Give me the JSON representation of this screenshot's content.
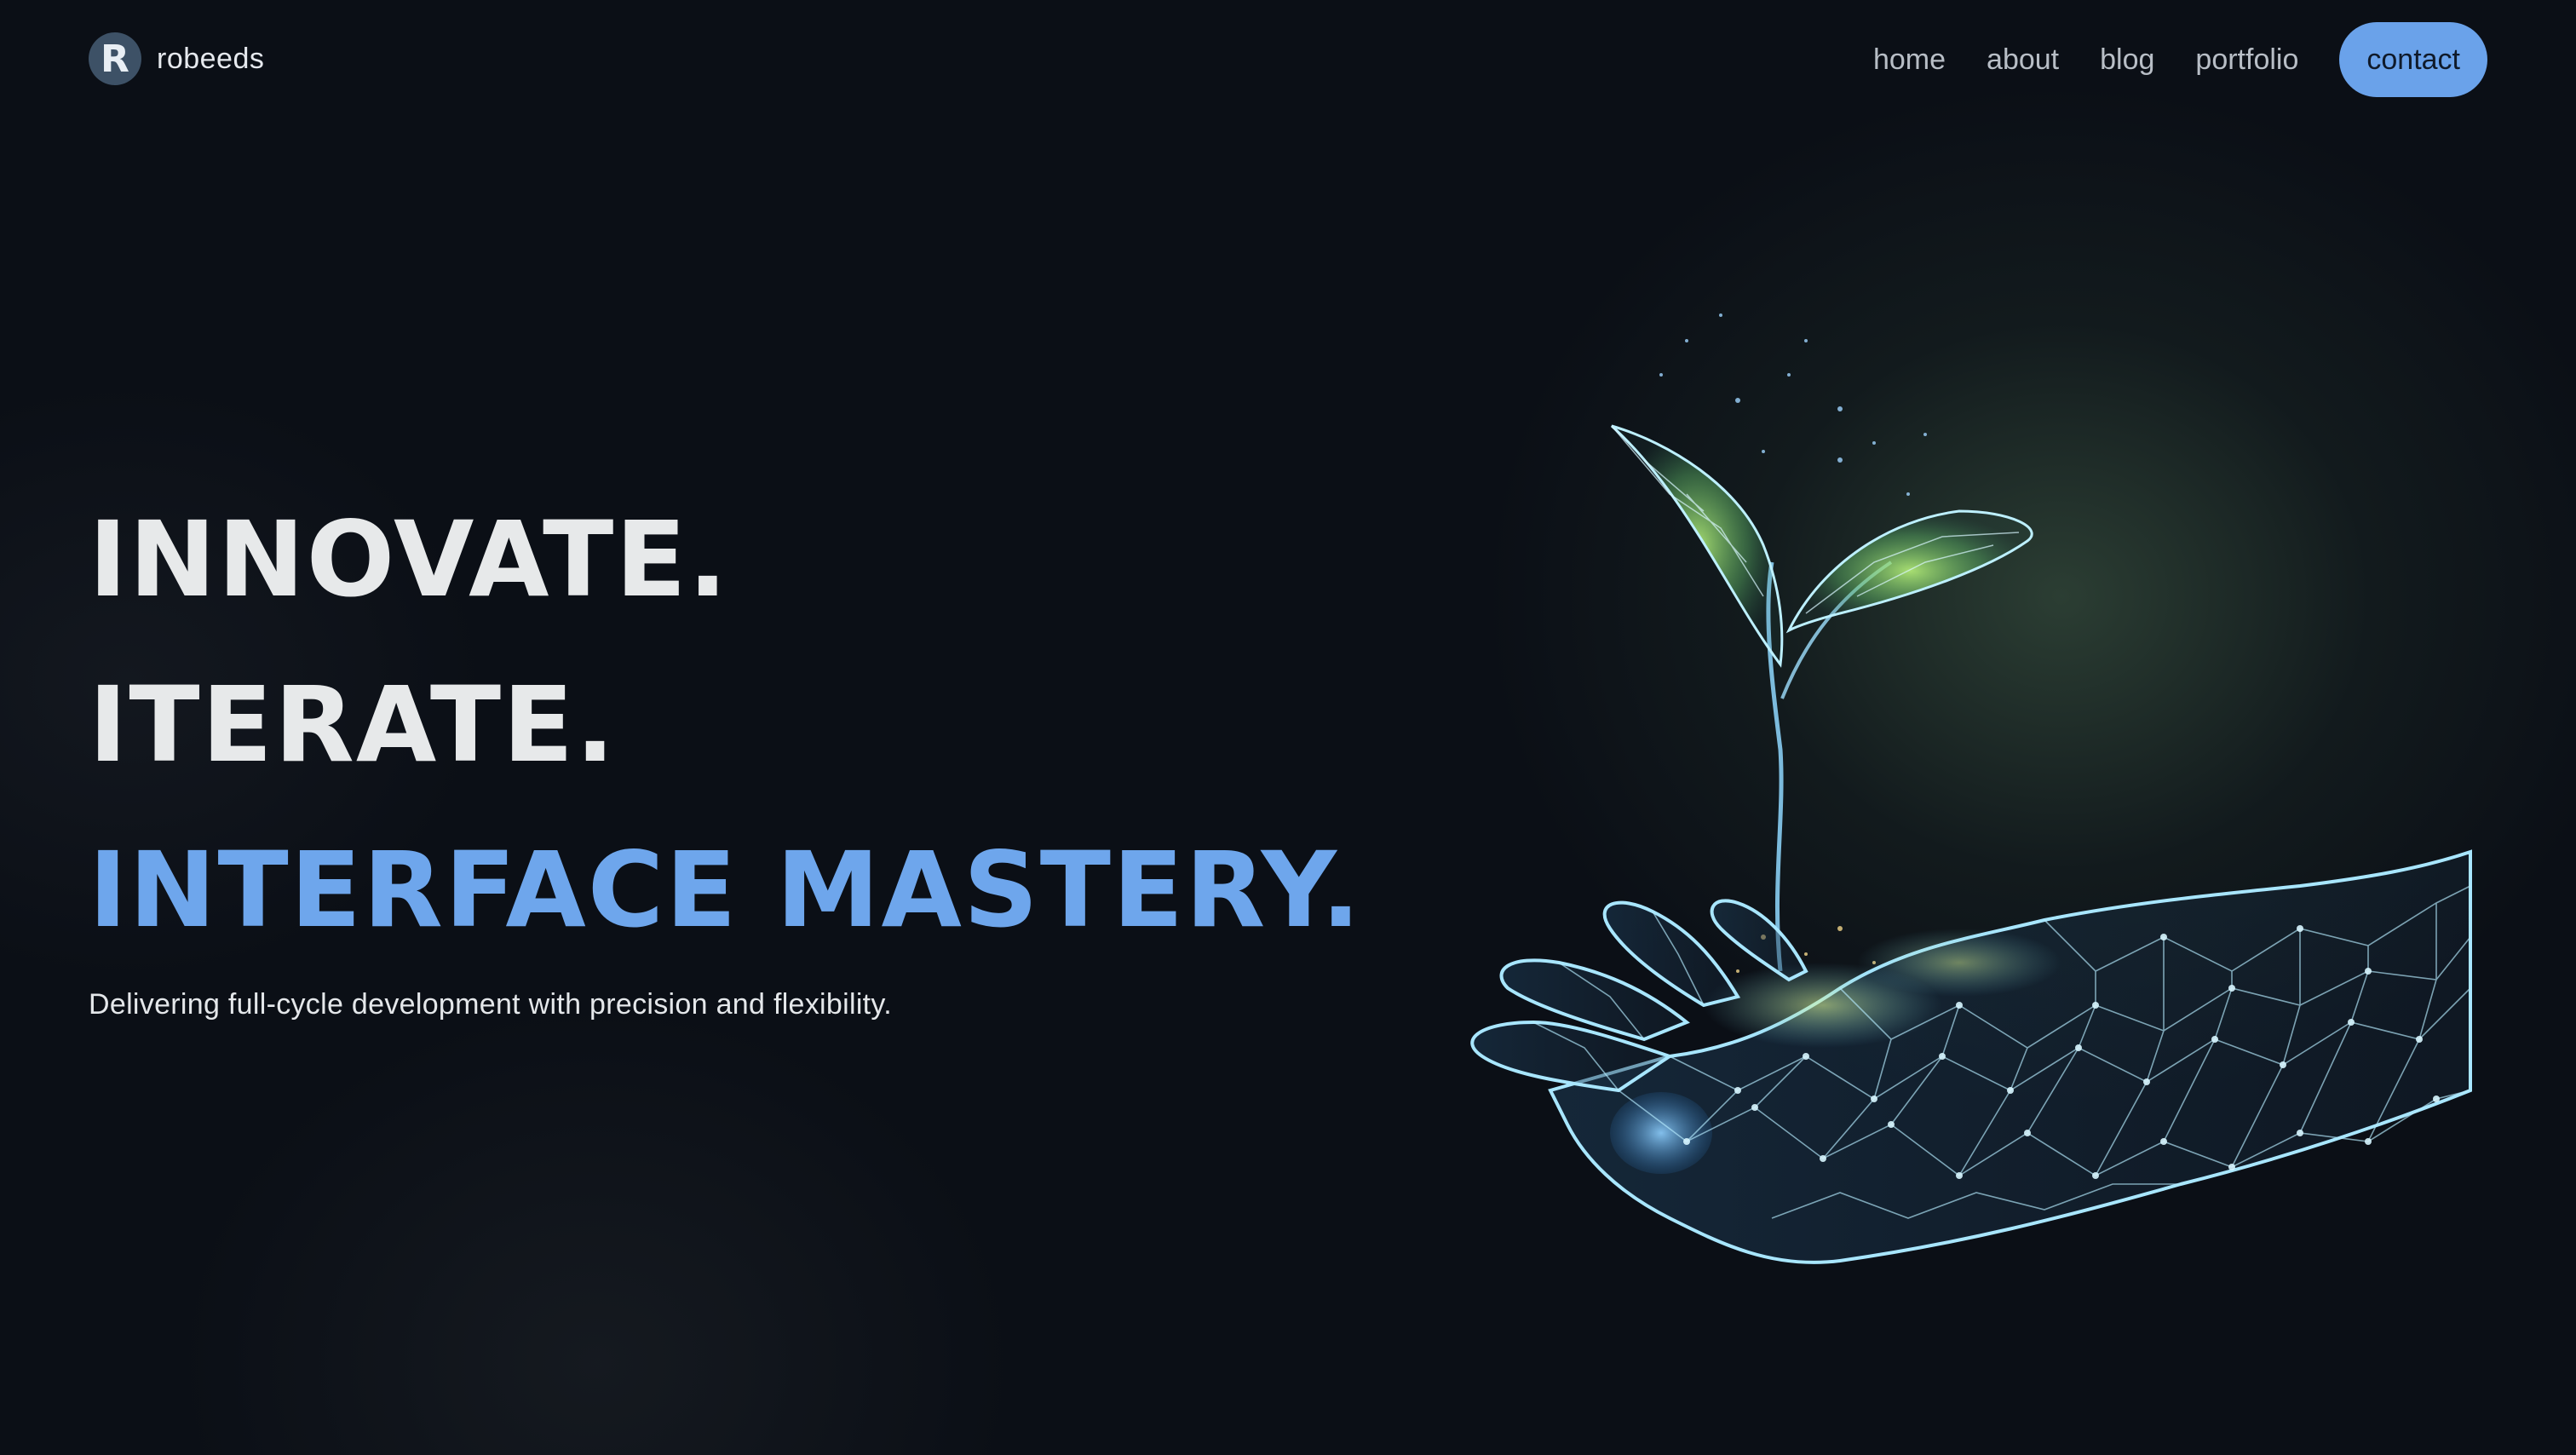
{
  "brand": {
    "logo_letter": "R",
    "name": "robeeds"
  },
  "nav": {
    "links": [
      "home",
      "about",
      "blog",
      "portfolio"
    ],
    "contact_label": "contact"
  },
  "hero": {
    "line1": "INNOVATE.",
    "line2": "ITERATE.",
    "line3": "INTERFACE MASTERY.",
    "subtitle": "Delivering full-cycle development with precision and flexibility."
  },
  "colors": {
    "background": "#0b0f16",
    "accent": "#6ea6ec",
    "button": "#6aa2ea",
    "text": "#e7e9ea"
  },
  "illustration": {
    "icon": "wireframe-hand-holding-sprout-icon"
  }
}
